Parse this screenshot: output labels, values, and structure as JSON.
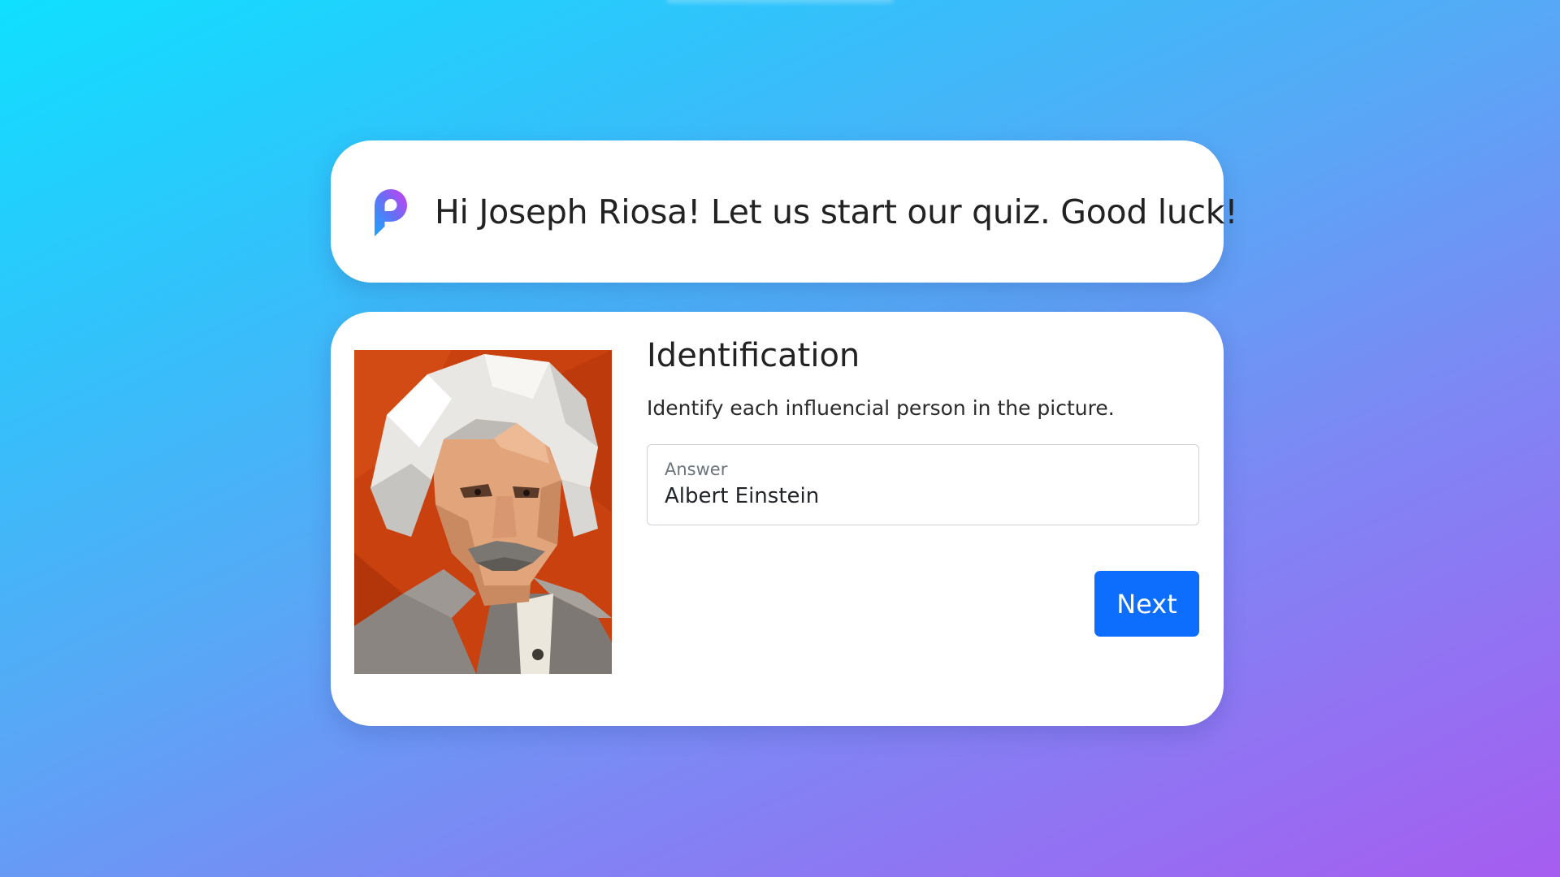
{
  "greeting": {
    "text": "Hi Joseph Riosa! Let us start our quiz. Good luck!",
    "logo_icon": "p-logo-icon"
  },
  "quiz": {
    "title": "Identification",
    "instruction": "Identify each influencial person in the picture.",
    "image_icon": "portrait-image",
    "answer": {
      "label": "Answer",
      "value": "Albert Einstein"
    },
    "next_label": "Next"
  },
  "colors": {
    "primary_button": "#0d6efd",
    "background_start": "#0fe0ff",
    "background_end": "#a65df0",
    "logo_gradient_start": "#1ea0ff",
    "logo_gradient_end": "#c93bf2"
  }
}
